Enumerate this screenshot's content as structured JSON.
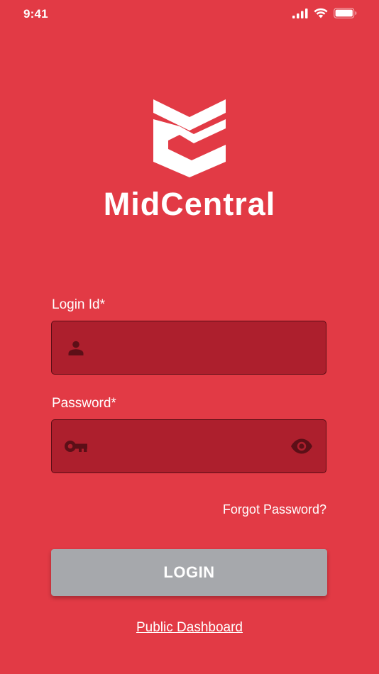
{
  "status_bar": {
    "time": "9:41",
    "icons": [
      "cellular-signal-icon",
      "wifi-icon",
      "battery-icon"
    ]
  },
  "brand": {
    "name": "MidCentral",
    "logo_icon": "midcentral-chevron-logo"
  },
  "form": {
    "login_id": {
      "label": "Login Id*",
      "value": "",
      "placeholder": "",
      "icon": "user-icon"
    },
    "password": {
      "label": "Password*",
      "value": "",
      "placeholder": "",
      "icon": "key-icon",
      "toggle_icon": "eye-icon"
    },
    "forgot_password": "Forgot Password?",
    "login_button": "LOGIN"
  },
  "footer": {
    "public_dashboard": "Public Dashboard"
  },
  "colors": {
    "background": "#E23A45",
    "input_background": "#AD1F2D",
    "input_border": "#5A0D15",
    "icon_color": "#5C0F17",
    "button_background": "#A6A8AC",
    "text": "#FFFFFF"
  }
}
